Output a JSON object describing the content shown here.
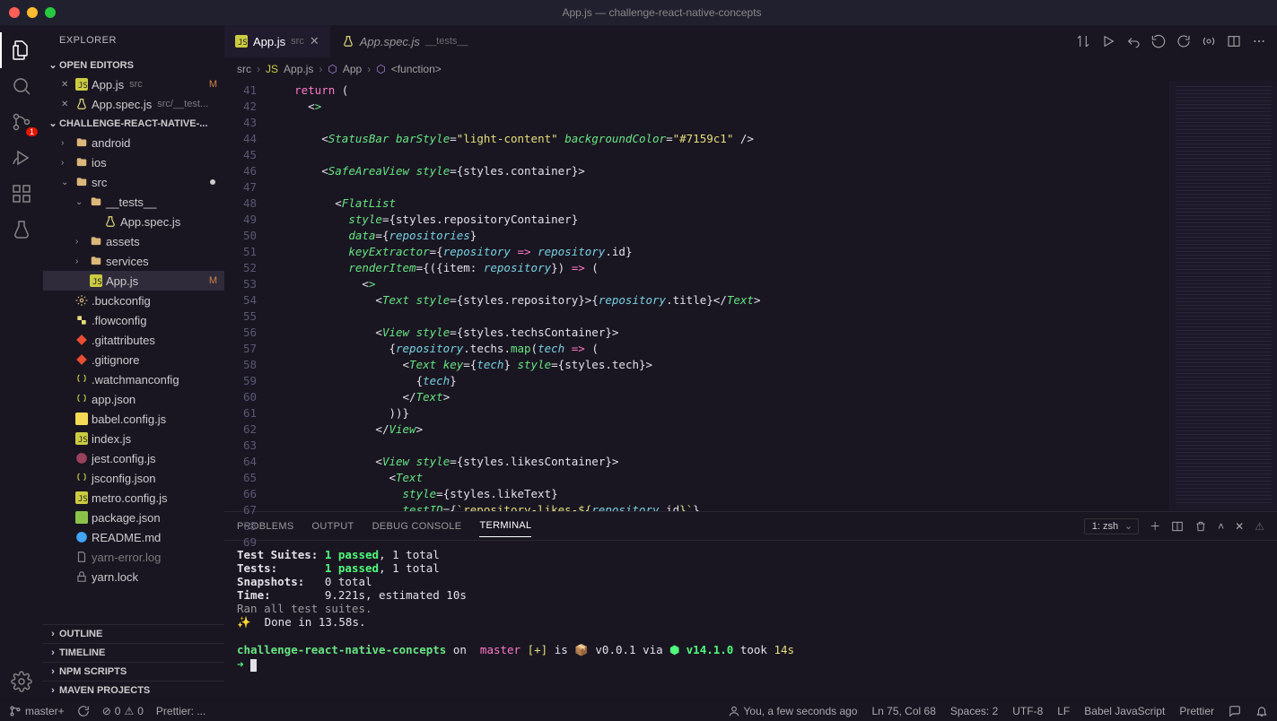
{
  "window": {
    "title": "App.js — challenge-react-native-concepts"
  },
  "activity": {
    "badge_scm": "1"
  },
  "sidebar": {
    "title": "EXPLORER",
    "sections": {
      "open_editors": "OPEN EDITORS",
      "workspace": "CHALLENGE-REACT-NATIVE-...",
      "outline": "OUTLINE",
      "timeline": "TIMELINE",
      "npm": "NPM SCRIPTS",
      "maven": "MAVEN PROJECTS"
    },
    "open_editors": [
      {
        "name": "App.js",
        "sub": "src",
        "status": "M"
      },
      {
        "name": "App.spec.js",
        "sub": "src/__test...",
        "status": ""
      }
    ],
    "tree": [
      {
        "type": "folder",
        "name": "android",
        "depth": 1,
        "chev": ">"
      },
      {
        "type": "folder",
        "name": "ios",
        "depth": 1,
        "chev": ">"
      },
      {
        "type": "folder",
        "name": "src",
        "depth": 1,
        "chev": "v",
        "dot": true
      },
      {
        "type": "folder",
        "name": "__tests__",
        "depth": 2,
        "chev": "v"
      },
      {
        "type": "file",
        "name": "App.spec.js",
        "depth": 3,
        "icon": "flask"
      },
      {
        "type": "folder",
        "name": "assets",
        "depth": 2,
        "chev": ">"
      },
      {
        "type": "folder",
        "name": "services",
        "depth": 2,
        "chev": ">"
      },
      {
        "type": "file",
        "name": "App.js",
        "depth": 2,
        "icon": "js",
        "status": "M",
        "active": true
      },
      {
        "type": "file",
        "name": ".buckconfig",
        "depth": 1,
        "icon": "cog"
      },
      {
        "type": "file",
        "name": ".flowconfig",
        "depth": 1,
        "icon": "flow"
      },
      {
        "type": "file",
        "name": ".gitattributes",
        "depth": 1,
        "icon": "git"
      },
      {
        "type": "file",
        "name": ".gitignore",
        "depth": 1,
        "icon": "git"
      },
      {
        "type": "file",
        "name": ".watchmanconfig",
        "depth": 1,
        "icon": "json"
      },
      {
        "type": "file",
        "name": "app.json",
        "depth": 1,
        "icon": "json"
      },
      {
        "type": "file",
        "name": "babel.config.js",
        "depth": 1,
        "icon": "babel"
      },
      {
        "type": "file",
        "name": "index.js",
        "depth": 1,
        "icon": "js"
      },
      {
        "type": "file",
        "name": "jest.config.js",
        "depth": 1,
        "icon": "jest"
      },
      {
        "type": "file",
        "name": "jsconfig.json",
        "depth": 1,
        "icon": "json"
      },
      {
        "type": "file",
        "name": "metro.config.js",
        "depth": 1,
        "icon": "js"
      },
      {
        "type": "file",
        "name": "package.json",
        "depth": 1,
        "icon": "npm"
      },
      {
        "type": "file",
        "name": "README.md",
        "depth": 1,
        "icon": "info"
      },
      {
        "type": "file",
        "name": "yarn-error.log",
        "depth": 1,
        "icon": "log",
        "dim": true
      },
      {
        "type": "file",
        "name": "yarn.lock",
        "depth": 1,
        "icon": "lock"
      }
    ]
  },
  "tabs": [
    {
      "name": "App.js",
      "sub": "src",
      "active": true,
      "icon": "js"
    },
    {
      "name": "App.spec.js",
      "sub": "__tests__",
      "active": false,
      "icon": "flask"
    }
  ],
  "breadcrumb": [
    "src",
    "App.js",
    "App",
    "<function>"
  ],
  "line_start": 41,
  "line_end": 69,
  "panel": {
    "tabs": {
      "problems": "PROBLEMS",
      "output": "OUTPUT",
      "debug": "DEBUG CONSOLE",
      "terminal": "TERMINAL"
    },
    "shell_select": "1: zsh",
    "terminal_lines": {
      "suites_label": "Test Suites:",
      "suites_pass": "1 passed",
      "suites_total": ", 1 total",
      "tests_label": "Tests:",
      "tests_pass": "1 passed",
      "tests_total": ", 1 total",
      "snap_label": "Snapshots:",
      "snap_val": "0 total",
      "time_label": "Time:",
      "time_val": "9.221s, estimated 10s",
      "ran": "Ran all test suites.",
      "done": "✨  Done in 13.58s.",
      "prompt_repo": "challenge-react-native-concepts",
      "prompt_on": " on ",
      "prompt_branch": "master",
      "prompt_star": " [+] ",
      "prompt_is": "is ",
      "prompt_pkg": "📦 v0.0.1 ",
      "prompt_via": "via ",
      "prompt_node": "⬢ v14.1.0 ",
      "prompt_took": "took ",
      "prompt_time": "14s",
      "arrow": "➜ "
    }
  },
  "status": {
    "branch": "master+",
    "sync": "",
    "errors": "0",
    "warnings": "0",
    "prettier_left": "Prettier: ...",
    "blame": "You, a few seconds ago",
    "cursor": "Ln 75, Col 68",
    "spaces": "Spaces: 2",
    "encoding": "UTF-8",
    "eol": "LF",
    "language": "Babel JavaScript",
    "formatter": "Prettier"
  }
}
